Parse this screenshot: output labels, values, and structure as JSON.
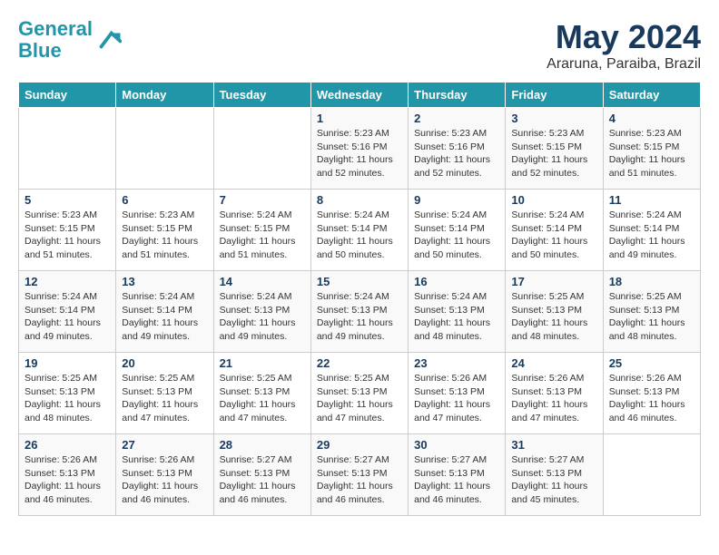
{
  "logo": {
    "line1": "General",
    "line2": "Blue"
  },
  "title": "May 2024",
  "location": "Araruna, Paraiba, Brazil",
  "weekdays": [
    "Sunday",
    "Monday",
    "Tuesday",
    "Wednesday",
    "Thursday",
    "Friday",
    "Saturday"
  ],
  "weeks": [
    [
      {
        "day": "",
        "info": ""
      },
      {
        "day": "",
        "info": ""
      },
      {
        "day": "",
        "info": ""
      },
      {
        "day": "1",
        "info": "Sunrise: 5:23 AM\nSunset: 5:16 PM\nDaylight: 11 hours\nand 52 minutes."
      },
      {
        "day": "2",
        "info": "Sunrise: 5:23 AM\nSunset: 5:16 PM\nDaylight: 11 hours\nand 52 minutes."
      },
      {
        "day": "3",
        "info": "Sunrise: 5:23 AM\nSunset: 5:15 PM\nDaylight: 11 hours\nand 52 minutes."
      },
      {
        "day": "4",
        "info": "Sunrise: 5:23 AM\nSunset: 5:15 PM\nDaylight: 11 hours\nand 51 minutes."
      }
    ],
    [
      {
        "day": "5",
        "info": "Sunrise: 5:23 AM\nSunset: 5:15 PM\nDaylight: 11 hours\nand 51 minutes."
      },
      {
        "day": "6",
        "info": "Sunrise: 5:23 AM\nSunset: 5:15 PM\nDaylight: 11 hours\nand 51 minutes."
      },
      {
        "day": "7",
        "info": "Sunrise: 5:24 AM\nSunset: 5:15 PM\nDaylight: 11 hours\nand 51 minutes."
      },
      {
        "day": "8",
        "info": "Sunrise: 5:24 AM\nSunset: 5:14 PM\nDaylight: 11 hours\nand 50 minutes."
      },
      {
        "day": "9",
        "info": "Sunrise: 5:24 AM\nSunset: 5:14 PM\nDaylight: 11 hours\nand 50 minutes."
      },
      {
        "day": "10",
        "info": "Sunrise: 5:24 AM\nSunset: 5:14 PM\nDaylight: 11 hours\nand 50 minutes."
      },
      {
        "day": "11",
        "info": "Sunrise: 5:24 AM\nSunset: 5:14 PM\nDaylight: 11 hours\nand 49 minutes."
      }
    ],
    [
      {
        "day": "12",
        "info": "Sunrise: 5:24 AM\nSunset: 5:14 PM\nDaylight: 11 hours\nand 49 minutes."
      },
      {
        "day": "13",
        "info": "Sunrise: 5:24 AM\nSunset: 5:14 PM\nDaylight: 11 hours\nand 49 minutes."
      },
      {
        "day": "14",
        "info": "Sunrise: 5:24 AM\nSunset: 5:13 PM\nDaylight: 11 hours\nand 49 minutes."
      },
      {
        "day": "15",
        "info": "Sunrise: 5:24 AM\nSunset: 5:13 PM\nDaylight: 11 hours\nand 49 minutes."
      },
      {
        "day": "16",
        "info": "Sunrise: 5:24 AM\nSunset: 5:13 PM\nDaylight: 11 hours\nand 48 minutes."
      },
      {
        "day": "17",
        "info": "Sunrise: 5:25 AM\nSunset: 5:13 PM\nDaylight: 11 hours\nand 48 minutes."
      },
      {
        "day": "18",
        "info": "Sunrise: 5:25 AM\nSunset: 5:13 PM\nDaylight: 11 hours\nand 48 minutes."
      }
    ],
    [
      {
        "day": "19",
        "info": "Sunrise: 5:25 AM\nSunset: 5:13 PM\nDaylight: 11 hours\nand 48 minutes."
      },
      {
        "day": "20",
        "info": "Sunrise: 5:25 AM\nSunset: 5:13 PM\nDaylight: 11 hours\nand 47 minutes."
      },
      {
        "day": "21",
        "info": "Sunrise: 5:25 AM\nSunset: 5:13 PM\nDaylight: 11 hours\nand 47 minutes."
      },
      {
        "day": "22",
        "info": "Sunrise: 5:25 AM\nSunset: 5:13 PM\nDaylight: 11 hours\nand 47 minutes."
      },
      {
        "day": "23",
        "info": "Sunrise: 5:26 AM\nSunset: 5:13 PM\nDaylight: 11 hours\nand 47 minutes."
      },
      {
        "day": "24",
        "info": "Sunrise: 5:26 AM\nSunset: 5:13 PM\nDaylight: 11 hours\nand 47 minutes."
      },
      {
        "day": "25",
        "info": "Sunrise: 5:26 AM\nSunset: 5:13 PM\nDaylight: 11 hours\nand 46 minutes."
      }
    ],
    [
      {
        "day": "26",
        "info": "Sunrise: 5:26 AM\nSunset: 5:13 PM\nDaylight: 11 hours\nand 46 minutes."
      },
      {
        "day": "27",
        "info": "Sunrise: 5:26 AM\nSunset: 5:13 PM\nDaylight: 11 hours\nand 46 minutes."
      },
      {
        "day": "28",
        "info": "Sunrise: 5:27 AM\nSunset: 5:13 PM\nDaylight: 11 hours\nand 46 minutes."
      },
      {
        "day": "29",
        "info": "Sunrise: 5:27 AM\nSunset: 5:13 PM\nDaylight: 11 hours\nand 46 minutes."
      },
      {
        "day": "30",
        "info": "Sunrise: 5:27 AM\nSunset: 5:13 PM\nDaylight: 11 hours\nand 46 minutes."
      },
      {
        "day": "31",
        "info": "Sunrise: 5:27 AM\nSunset: 5:13 PM\nDaylight: 11 hours\nand 45 minutes."
      },
      {
        "day": "",
        "info": ""
      }
    ]
  ]
}
